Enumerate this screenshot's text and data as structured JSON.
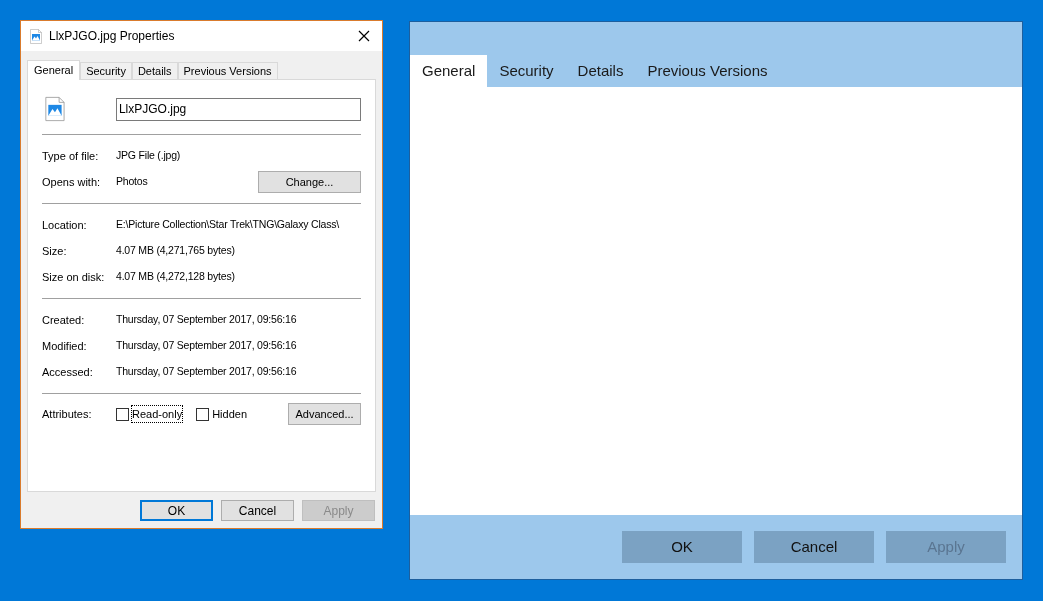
{
  "dialog": {
    "title": "LlxPJGO.jpg Properties",
    "tabs": [
      {
        "label": "General",
        "selected": true
      },
      {
        "label": "Security",
        "selected": false
      },
      {
        "label": "Details",
        "selected": false
      },
      {
        "label": "Previous Versions",
        "selected": false
      }
    ],
    "file_name": {
      "value": "LlxPJGO.jpg"
    },
    "sections": [
      [
        {
          "label": "Type of file:",
          "value": "JPG File (.jpg)"
        },
        {
          "label": "Opens with:",
          "value": "Photos",
          "button": "Change..."
        }
      ],
      [
        {
          "label": "Location:",
          "value": "E:\\Picture Collection\\Star Trek\\TNG\\Galaxy Class\\"
        },
        {
          "label": "Size:",
          "value": "4.07 MB (4,271,765 bytes)"
        },
        {
          "label": "Size on disk:",
          "value": "4.07 MB (4,272,128 bytes)"
        }
      ],
      [
        {
          "label": "Created:",
          "value": "Thursday, 07 September 2017, 09:56:16"
        },
        {
          "label": "Modified:",
          "value": "Thursday, 07 September 2017, 09:56:16"
        },
        {
          "label": "Accessed:",
          "value": "Thursday, 07 September 2017, 09:56:16"
        }
      ]
    ],
    "attributes": {
      "label": "Attributes:",
      "checkboxes": [
        {
          "label": "Read-only",
          "checked": false,
          "focused": true
        },
        {
          "label": "Hidden",
          "checked": false,
          "focused": false
        }
      ],
      "button": "Advanced..."
    },
    "buttons": [
      {
        "label": "OK",
        "default": true,
        "disabled": false
      },
      {
        "label": "Cancel",
        "default": false,
        "disabled": false
      },
      {
        "label": "Apply",
        "default": false,
        "disabled": true
      }
    ]
  },
  "preview": {
    "tabs": [
      {
        "label": "General",
        "selected": true
      },
      {
        "label": "Security",
        "selected": false
      },
      {
        "label": "Details",
        "selected": false
      },
      {
        "label": "Previous Versions",
        "selected": false
      }
    ],
    "buttons": [
      {
        "label": "OK",
        "disabled": false
      },
      {
        "label": "Cancel",
        "disabled": false
      },
      {
        "label": "Apply",
        "disabled": true
      }
    ]
  }
}
